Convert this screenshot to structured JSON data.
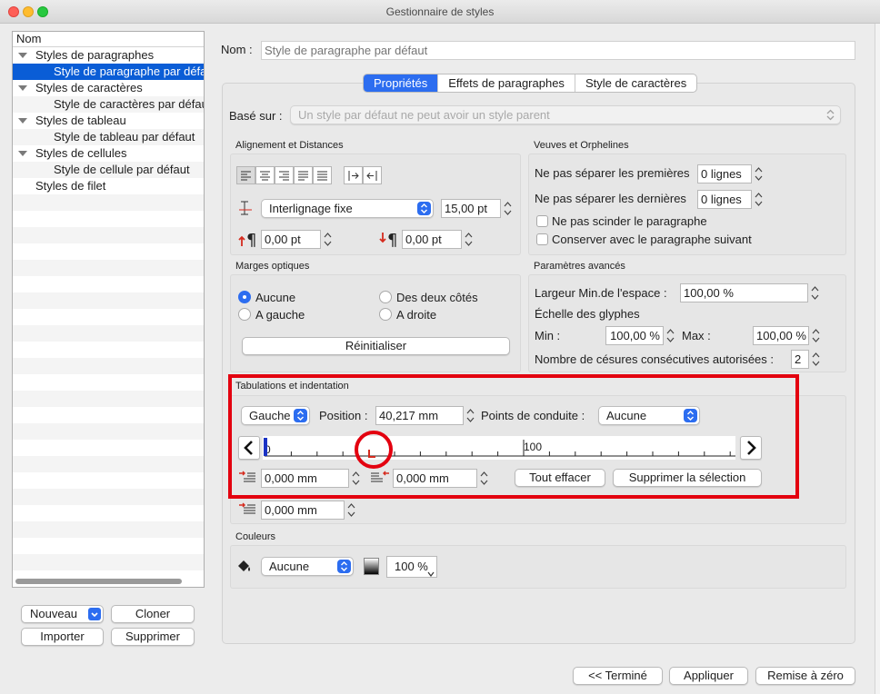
{
  "window": {
    "title": "Gestionnaire de styles"
  },
  "tree": {
    "header": "Nom",
    "items": [
      {
        "label": "Styles de paragraphes",
        "level": 0,
        "expanded": true
      },
      {
        "label": "Style de paragraphe par défaut",
        "level": 1,
        "selected": true
      },
      {
        "label": "Styles de caractères",
        "level": 0,
        "expanded": true
      },
      {
        "label": "Style de caractères par défaut",
        "level": 1
      },
      {
        "label": "Styles de tableau",
        "level": 0,
        "expanded": true
      },
      {
        "label": "Style de tableau par défaut",
        "level": 1
      },
      {
        "label": "Styles de cellules",
        "level": 0,
        "expanded": true
      },
      {
        "label": "Style de cellule par défaut",
        "level": 1
      },
      {
        "label": "Styles de filet",
        "level": 0
      }
    ]
  },
  "left_buttons": {
    "new": "Nouveau",
    "clone": "Cloner",
    "import": "Importer",
    "delete": "Supprimer"
  },
  "name": {
    "label": "Nom :",
    "placeholder": "Style de paragraphe par défaut"
  },
  "tabs": [
    "Propriétés",
    "Effets de paragraphes",
    "Style de caractères"
  ],
  "based_on": {
    "label": "Basé sur :",
    "value": "Un style par défaut ne peut avoir un style parent"
  },
  "alignment": {
    "title": "Alignement et Distances",
    "line_spacing_mode": "Interlignage fixe",
    "line_spacing": "15,00 pt",
    "space_before": "0,00 pt",
    "space_after": "0,00 pt"
  },
  "widows": {
    "title": "Veuves et Orphelines",
    "keep_first_label": "Ne pas séparer les premières",
    "keep_first": "0 lignes",
    "keep_last_label": "Ne pas séparer les dernières",
    "keep_last": "0 lignes",
    "dont_split": "Ne pas scinder le paragraphe",
    "keep_next": "Conserver avec le paragraphe suivant"
  },
  "optical": {
    "title": "Marges optiques",
    "none": "Aucune",
    "both": "Des deux côtés",
    "left": "A gauche",
    "right": "A droite",
    "reset": "Réinitialiser"
  },
  "advanced": {
    "title": "Paramètres avancés",
    "min_space_label": "Largeur Min.de l'espace :",
    "min_space": "100,00 %",
    "glyph_label": "Échelle des glyphes",
    "min_label": "Min :",
    "min": "100,00 %",
    "max_label": "Max :",
    "max": "100,00 %",
    "hyphen_label": "Nombre de césures consécutives autorisées :",
    "hyphen": "2"
  },
  "tabs_indent": {
    "title": "Tabulations et indentation",
    "tab_type": "Gauche",
    "position_label": "Position :",
    "position": "40,217 mm",
    "leader_label": "Points de conduite :",
    "leader": "Aucune",
    "ruler_0": "0",
    "ruler_100": "100",
    "left_indent": "0,000 mm",
    "right_indent": "0,000 mm",
    "first_indent": "0,000 mm",
    "clear_all": "Tout effacer",
    "delete_sel": "Supprimer la sélection"
  },
  "colors": {
    "title": "Couleurs",
    "fill": "Aucune",
    "shade": "100 %"
  },
  "footer": {
    "done": "<< Terminé",
    "apply": "Appliquer",
    "reset": "Remise à zéro"
  },
  "accent": "#2c6df0",
  "highlight": "#e3000f"
}
